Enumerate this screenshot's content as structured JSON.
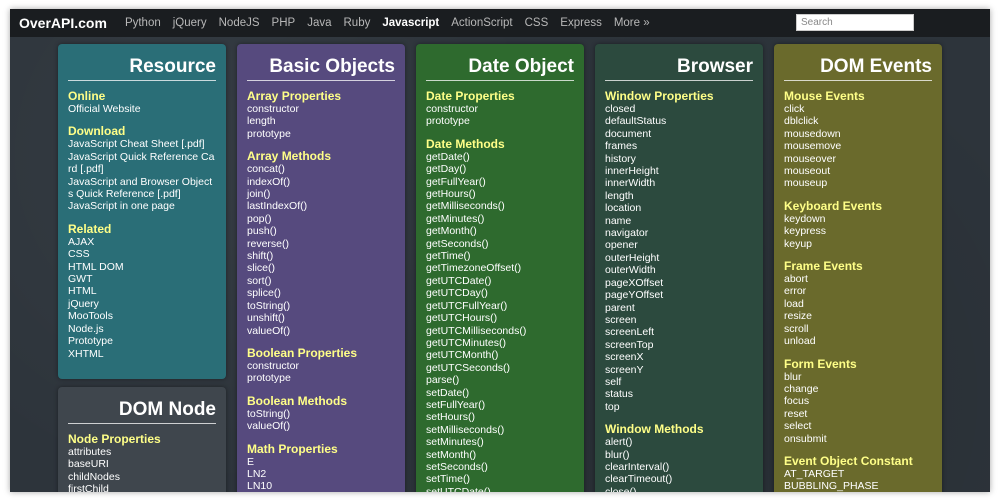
{
  "header": {
    "logo": "OverAPI.com",
    "nav": [
      "Python",
      "jQuery",
      "NodeJS",
      "PHP",
      "Java",
      "Ruby",
      "Javascript",
      "ActionScript",
      "CSS",
      "Express",
      "More »"
    ],
    "active_nav": "Javascript",
    "search_placeholder": "Search"
  },
  "cards": {
    "resource": {
      "title": "Resource",
      "sections": [
        {
          "title": "Online",
          "items": [
            "Official Website"
          ]
        },
        {
          "title": "Download",
          "items": [
            "JavaScript Cheat Sheet [.pdf]",
            "JavaScript Quick Reference Ca rd [.pdf]",
            "JavaScript and Browser Objects Quick Reference [.pdf]",
            "JavaScript in one page"
          ]
        },
        {
          "title": "Related",
          "items": [
            "AJAX",
            "CSS",
            "HTML DOM",
            "GWT",
            "HTML",
            "jQuery",
            "MooTools",
            "Node.js",
            "Prototype",
            "XHTML"
          ]
        }
      ]
    },
    "domnode": {
      "title": "DOM Node",
      "sections": [
        {
          "title": "Node Properties",
          "items": [
            "attributes",
            "baseURI",
            "childNodes",
            "firstChild"
          ]
        }
      ]
    },
    "basic": {
      "title": "Basic Objects",
      "sections": [
        {
          "title": "Array Properties",
          "items": [
            "constructor",
            "length",
            "prototype"
          ]
        },
        {
          "title": "Array Methods",
          "items": [
            "concat()",
            "indexOf()",
            "join()",
            "lastIndexOf()",
            "pop()",
            "push()",
            "reverse()",
            "shift()",
            "slice()",
            "sort()",
            "splice()",
            "toString()",
            "unshift()",
            "valueOf()"
          ]
        },
        {
          "title": "Boolean Properties",
          "items": [
            "constructor",
            "prototype"
          ]
        },
        {
          "title": "Boolean Methods",
          "items": [
            "toString()",
            "valueOf()"
          ]
        },
        {
          "title": "Math Properties",
          "items": [
            "E",
            "LN2",
            "LN10"
          ]
        }
      ]
    },
    "date": {
      "title": "Date Object",
      "sections": [
        {
          "title": "Date Properties",
          "items": [
            "constructor",
            "prototype"
          ]
        },
        {
          "title": "Date Methods",
          "items": [
            "getDate()",
            "getDay()",
            "getFullYear()",
            "getHours()",
            "getMilliseconds()",
            "getMinutes()",
            "getMonth()",
            "getSeconds()",
            "getTime()",
            "getTimezoneOffset()",
            "getUTCDate()",
            "getUTCDay()",
            "getUTCFullYear()",
            "getUTCHours()",
            "getUTCMilliseconds()",
            "getUTCMinutes()",
            "getUTCMonth()",
            "getUTCSeconds()",
            "parse()",
            "setDate()",
            "setFullYear()",
            "setHours()",
            "setMilliseconds()",
            "setMinutes()",
            "setMonth()",
            "setSeconds()",
            "setTime()",
            "setUTCDate()"
          ]
        }
      ]
    },
    "browser": {
      "title": "Browser",
      "sections": [
        {
          "title": "Window Properties",
          "items": [
            "closed",
            "defaultStatus",
            "document",
            "frames",
            "history",
            "innerHeight",
            "innerWidth",
            "length",
            "location",
            "name",
            "navigator",
            "opener",
            "outerHeight",
            "outerWidth",
            "pageXOffset",
            "pageYOffset",
            "parent",
            "screen",
            "screenLeft",
            "screenTop",
            "screenX",
            "screenY",
            "self",
            "status",
            "top"
          ]
        },
        {
          "title": "Window Methods",
          "items": [
            "alert()",
            "blur()",
            "clearInterval()",
            "clearTimeout()",
            "close()"
          ]
        }
      ]
    },
    "dom": {
      "title": "DOM Events",
      "sections": [
        {
          "title": "Mouse Events",
          "items": [
            "click",
            "dblclick",
            "mousedown",
            "mousemove",
            "mouseover",
            "mouseout",
            "mouseup"
          ]
        },
        {
          "title": "Keyboard Events",
          "items": [
            "keydown",
            "keypress",
            "keyup"
          ]
        },
        {
          "title": "Frame Events",
          "items": [
            "abort",
            "error",
            "load",
            "resize",
            "scroll",
            "unload"
          ]
        },
        {
          "title": "Form Events",
          "items": [
            "blur",
            "change",
            "focus",
            "reset",
            "select",
            "onsubmit"
          ]
        },
        {
          "title": "Event Object Constant",
          "items": [
            "AT_TARGET",
            "BUBBLING_PHASE"
          ]
        }
      ]
    }
  },
  "colors": {
    "topbar": "#1a1d20",
    "background": "#2d343b",
    "resource": "#2a6e77",
    "domnode": "#3f464d",
    "basic": "#564a7e",
    "date": "#2e6a2e",
    "browser": "#2c4a3e",
    "dom": "#6a6a2c",
    "section_title": "#ffff88"
  }
}
